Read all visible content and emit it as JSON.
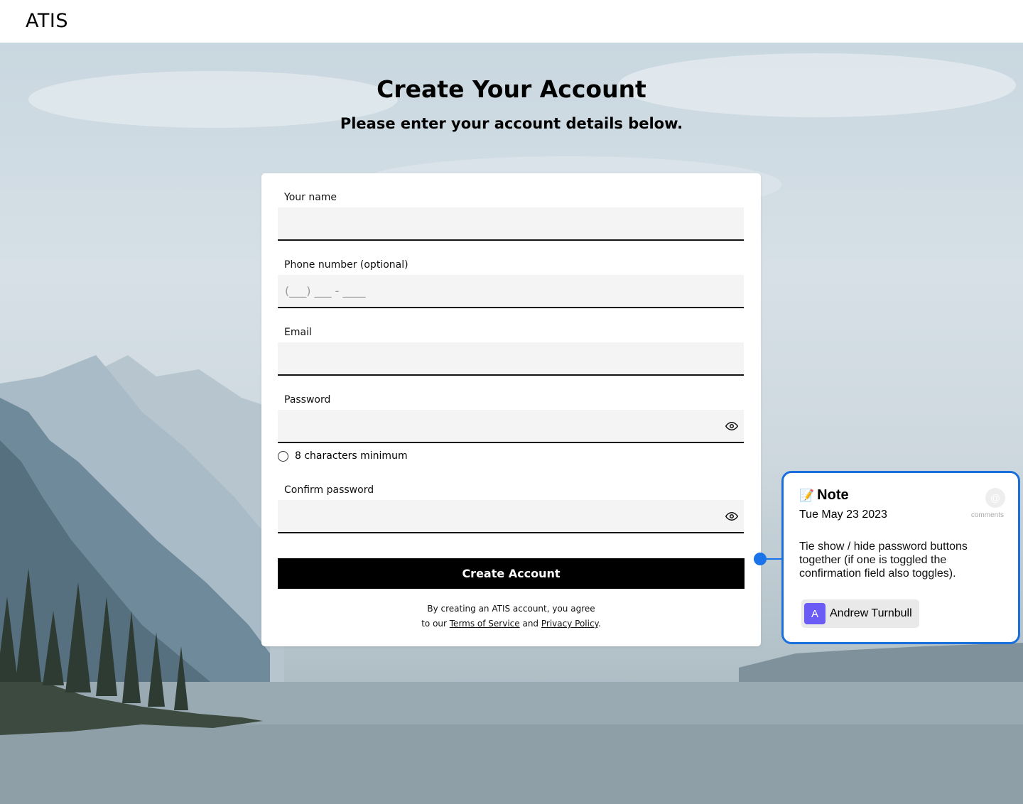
{
  "header": {
    "logo": "ATIS"
  },
  "page": {
    "title": "Create Your Account",
    "subtitle": "Please enter your account details below."
  },
  "form": {
    "name_label": "Your name",
    "phone_label": "Phone number (optional)",
    "phone_placeholder": "(___) ___ - ____",
    "email_label": "Email",
    "password_label": "Password",
    "password_hint": "8 characters minimum",
    "confirm_label": "Confirm password",
    "submit_label": "Create Account",
    "legal_line1": "By creating an ATIS account, you agree",
    "legal_prefix": "to our ",
    "terms_link": "Terms of Service",
    "legal_and": " and ",
    "privacy_link": "Privacy Policy",
    "legal_suffix": "."
  },
  "note": {
    "icon": "memo-icon",
    "title": "Note",
    "date": "Tue May 23 2023",
    "body": "Tie show / hide password buttons together (if one is toggled the confirmation field also toggles).",
    "comments_label": "comments",
    "author_initial": "A",
    "author_name": "Andrew Turnbull",
    "accent_color": "#1a6fdc",
    "avatar_color": "#6b5cf6"
  }
}
